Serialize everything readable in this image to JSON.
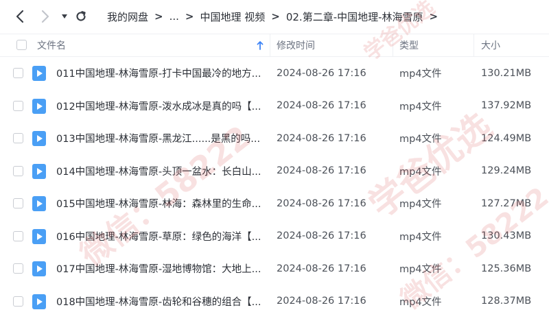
{
  "breadcrumb": [
    "我的网盘",
    "...",
    "中国地理 视频",
    "02.第二章-中国地理-林海雪原"
  ],
  "columns": {
    "name": "文件名",
    "mtime": "修改时间",
    "type": "类型",
    "size": "大小"
  },
  "rows": [
    {
      "name": "011中国地理-林海雪原-打卡中国最冷的地方...",
      "mtime": "2024-08-26 17:16",
      "type": "mp4文件",
      "size": "130.21MB"
    },
    {
      "name": "012中国地理-林海雪原-泼水成冰是真的吗【...",
      "mtime": "2024-08-26 17:16",
      "type": "mp4文件",
      "size": "137.92MB"
    },
    {
      "name": "013中国地理-林海雪原-黑龙江......是黑的吗...",
      "mtime": "2024-08-26 17:16",
      "type": "mp4文件",
      "size": "124.49MB"
    },
    {
      "name": "014中国地理-林海雪原-头顶一盆水：长白山...",
      "mtime": "2024-08-26 17:16",
      "type": "mp4文件",
      "size": "129.24MB"
    },
    {
      "name": "015中国地理-林海雪原-林海：森林里的生命...",
      "mtime": "2024-08-26 17:16",
      "type": "mp4文件",
      "size": "127.27MB"
    },
    {
      "name": "016中国地理-林海雪原-草原：绿色的海洋【...",
      "mtime": "2024-08-26 17:16",
      "type": "mp4文件",
      "size": "130.43MB"
    },
    {
      "name": "017中国地理-林海雪原-湿地博物馆：大地上...",
      "mtime": "2024-08-26 17:16",
      "type": "mp4文件",
      "size": "125.36MB"
    },
    {
      "name": "018中国地理-林海雪原-齿轮和谷穗的组合【...",
      "mtime": "2024-08-26 17:16",
      "type": "mp4文件",
      "size": "128.37MB"
    }
  ],
  "watermark": {
    "line1": "学爸优选",
    "line2": "微信：58222"
  },
  "colors": {
    "icon_blue": "#4a9ff5",
    "sort_arrow": "#3b82f6"
  }
}
